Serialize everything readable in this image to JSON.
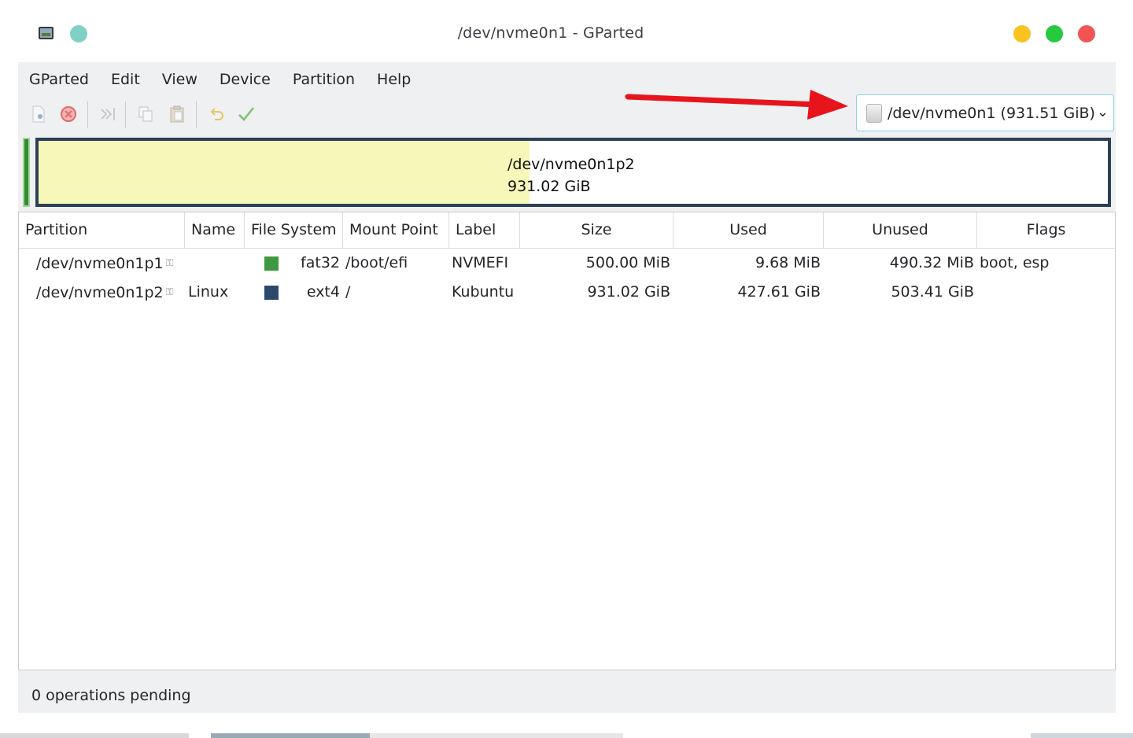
{
  "window": {
    "title": "/dev/nvme0n1 - GParted",
    "colors": {
      "minimize": "#f8c31e",
      "maximize": "#27c93f",
      "close": "#f25454",
      "pin": "#80d0c8"
    }
  },
  "menu": [
    "GParted",
    "Edit",
    "View",
    "Device",
    "Partition",
    "Help"
  ],
  "toolbar": {
    "buttons": [
      "new-icon",
      "delete-icon",
      "resize-move-icon",
      "copy-icon",
      "paste-icon",
      "undo-icon",
      "apply-icon"
    ]
  },
  "device_selector": {
    "label": "/dev/nvme0n1 (931.51 GiB)"
  },
  "partition_map": {
    "name": "/dev/nvme0n1p2",
    "size": "931.02 GiB",
    "used_fraction": 0.459,
    "colors": {
      "used": "#f7f7b9",
      "border": "#2b4058",
      "unallocated": "#2d8f2d"
    }
  },
  "table": {
    "headers": [
      "Partition",
      "Name",
      "File System",
      "Mount Point",
      "Label",
      "Size",
      "Used",
      "Unused",
      "Flags"
    ],
    "rows": [
      {
        "partition": "/dev/nvme0n1p1",
        "name": "",
        "fs_color": "#3f9a3f",
        "filesystem": "fat32",
        "mount": "/boot/efi",
        "label": "NVMEFI",
        "size": "500.00 MiB",
        "used": "9.68 MiB",
        "unused": "490.32 MiB",
        "flags": "boot, esp"
      },
      {
        "partition": "/dev/nvme0n1p2",
        "name": "Linux",
        "fs_color": "#2b4a6b",
        "filesystem": "ext4",
        "mount": "/",
        "label": "Kubuntu",
        "size": "931.02 GiB",
        "used": "427.61 GiB",
        "unused": "503.41 GiB",
        "flags": ""
      }
    ]
  },
  "status": {
    "text": "0 operations pending"
  }
}
